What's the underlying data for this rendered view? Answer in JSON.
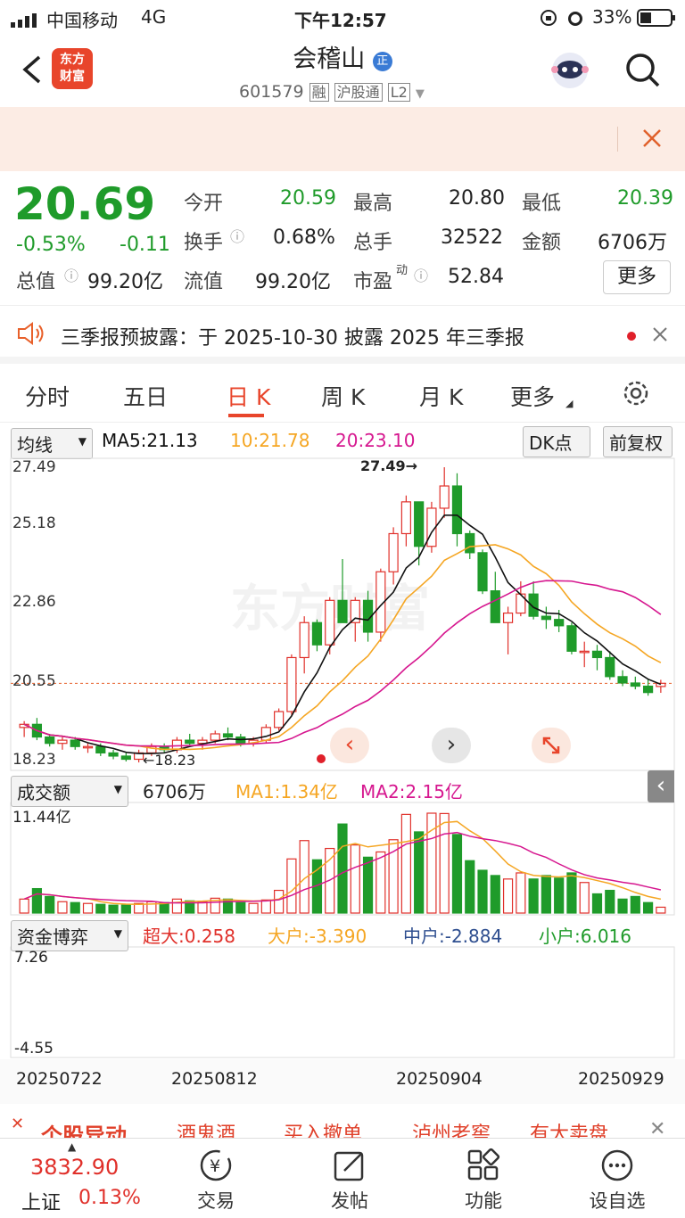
{
  "status": {
    "carrier": "中国移动",
    "network": "4G",
    "time": "下午12:57",
    "battery": "33%"
  },
  "header": {
    "title": "会稽山",
    "badge": "正",
    "code": "601579",
    "tags": [
      "融",
      "沪股通",
      "L2"
    ],
    "logo_line1": "东方",
    "logo_line2": "财富"
  },
  "quote": {
    "price": "20.69",
    "pct": "-0.53%",
    "chg": "-0.11",
    "fields": [
      {
        "l": "今开",
        "v": "20.59"
      },
      {
        "l": "最高",
        "v": "20.80"
      },
      {
        "l": "最低",
        "v": "20.39"
      },
      {
        "l": "换手",
        "v": "0.68%"
      },
      {
        "l": "总手",
        "v": "32522"
      },
      {
        "l": "金额",
        "v": "6706万"
      },
      {
        "l": "总值",
        "v": "99.20亿"
      },
      {
        "l": "流值",
        "v": "99.20亿"
      },
      {
        "l": "市盈",
        "sup": "动",
        "v": "52.84"
      }
    ],
    "more": "更多"
  },
  "notice": {
    "text": "三季报预披露：于 2025-10-30 披露 2025 年三季报"
  },
  "tabs": [
    "分时",
    "五日",
    "日 K",
    "周 K",
    "月 K",
    "更多",
    "settings"
  ],
  "kline": {
    "ma_select": "均线",
    "ma5": "MA5:21.13",
    "ma10": "10:21.78",
    "ma20": "20:23.10",
    "dk": "DK点",
    "adj": "前复权",
    "ymax": "27.49",
    "y2": "25.18",
    "y3": "22.86",
    "y4": "20.55",
    "ymin": "18.23",
    "high_label": "27.49→",
    "low_label": "←18.23",
    "watermark": "东方财富"
  },
  "volume": {
    "select": "成交额",
    "cur": "6706万",
    "ma1": "MA1:1.34亿",
    "ma2": "MA2:2.15亿",
    "ymax": "11.44亿"
  },
  "funds": {
    "select": "资金博弈",
    "big": "超大:0.258",
    "large": "大户:-3.390",
    "mid": "中户:-2.884",
    "small": "小户:6.016",
    "ymax": "7.26",
    "ymin": "-4.55"
  },
  "dates": [
    "20250722",
    "20250812",
    "20250904",
    "20250929"
  ],
  "ticker": {
    "title": "个股异动",
    "items": [
      "酒鬼酒",
      "买入撤单",
      "泸州老窖",
      "有大卖盘"
    ]
  },
  "bottom": {
    "index_value": "3832.90",
    "index_name": "上证",
    "index_pct": "0.13%",
    "items": [
      "交易",
      "发帖",
      "功能",
      "设自选"
    ]
  },
  "colors": {
    "up": "#e0302a",
    "down": "#1f9b2a",
    "ma5": "#111111",
    "ma10": "#f5a623",
    "ma20": "#d6178f"
  },
  "chart_data": {
    "type": "candlestick",
    "candles": [
      [
        19.3,
        19.5,
        19.0,
        19.4
      ],
      [
        19.4,
        19.6,
        18.9,
        19.0
      ],
      [
        19.0,
        19.1,
        18.7,
        18.8
      ],
      [
        18.8,
        19.0,
        18.6,
        18.9
      ],
      [
        18.9,
        19.0,
        18.6,
        18.7
      ],
      [
        18.7,
        18.8,
        18.5,
        18.7
      ],
      [
        18.7,
        18.8,
        18.4,
        18.5
      ],
      [
        18.5,
        18.6,
        18.3,
        18.4
      ],
      [
        18.4,
        18.5,
        18.23,
        18.3
      ],
      [
        18.3,
        18.6,
        18.2,
        18.5
      ],
      [
        18.5,
        18.8,
        18.4,
        18.7
      ],
      [
        18.7,
        18.8,
        18.5,
        18.6
      ],
      [
        18.6,
        19.0,
        18.5,
        18.9
      ],
      [
        18.9,
        19.1,
        18.7,
        18.8
      ],
      [
        18.8,
        19.0,
        18.6,
        18.9
      ],
      [
        18.9,
        19.2,
        18.8,
        19.1
      ],
      [
        19.1,
        19.3,
        18.9,
        19.0
      ],
      [
        19.0,
        19.1,
        18.7,
        18.8
      ],
      [
        18.8,
        19.0,
        18.7,
        18.9
      ],
      [
        18.9,
        19.4,
        18.8,
        19.3
      ],
      [
        19.3,
        19.9,
        19.2,
        19.8
      ],
      [
        19.8,
        21.6,
        19.7,
        21.5
      ],
      [
        21.5,
        22.8,
        21.0,
        22.6
      ],
      [
        22.6,
        22.7,
        21.7,
        21.9
      ],
      [
        21.9,
        23.4,
        21.6,
        23.3
      ],
      [
        23.3,
        24.6,
        22.6,
        22.6
      ],
      [
        22.6,
        23.4,
        22.0,
        23.3
      ],
      [
        23.3,
        23.6,
        22.0,
        22.3
      ],
      [
        22.3,
        24.3,
        22.0,
        24.2
      ],
      [
        24.2,
        25.6,
        23.8,
        25.4
      ],
      [
        25.4,
        26.6,
        25.0,
        26.4
      ],
      [
        26.4,
        25.9,
        24.4,
        25.0
      ],
      [
        25.0,
        26.4,
        24.8,
        26.2
      ],
      [
        26.2,
        27.49,
        25.9,
        26.9
      ],
      [
        26.9,
        27.3,
        25.0,
        25.4
      ],
      [
        25.4,
        25.5,
        24.6,
        24.8
      ],
      [
        24.8,
        24.9,
        23.5,
        23.6
      ],
      [
        23.6,
        24.2,
        22.7,
        22.6
      ],
      [
        22.6,
        23.1,
        21.6,
        22.9
      ],
      [
        22.9,
        23.9,
        22.8,
        23.5
      ],
      [
        23.5,
        23.9,
        22.7,
        22.8
      ],
      [
        22.8,
        23.1,
        22.4,
        22.7
      ],
      [
        22.7,
        23.0,
        22.3,
        22.5
      ],
      [
        22.5,
        22.6,
        21.6,
        21.7
      ],
      [
        21.7,
        22.0,
        21.2,
        21.7
      ],
      [
        21.7,
        21.9,
        21.1,
        21.5
      ],
      [
        21.5,
        21.7,
        20.8,
        20.9
      ],
      [
        20.9,
        21.1,
        20.6,
        20.7
      ],
      [
        20.7,
        20.9,
        20.5,
        20.6
      ],
      [
        20.6,
        20.8,
        20.3,
        20.4
      ],
      [
        20.59,
        20.8,
        20.39,
        20.69
      ]
    ],
    "volumes": [
      1.6,
      2.8,
      1.9,
      1.3,
      1.2,
      1.1,
      1.0,
      0.9,
      0.9,
      1.1,
      1.3,
      1.2,
      1.6,
      1.4,
      1.3,
      1.7,
      1.6,
      1.2,
      1.1,
      1.5,
      2.6,
      6.2,
      8.3,
      6.1,
      7.4,
      10.2,
      7.8,
      6.4,
      7.0,
      8.4,
      11.3,
      9.3,
      11.44,
      11.4,
      9.0,
      6.0,
      4.9,
      4.3,
      3.9,
      4.6,
      3.9,
      4.3,
      4.0,
      4.6,
      3.5,
      2.2,
      2.6,
      1.6,
      1.9,
      1.2,
      0.67
    ]
  }
}
